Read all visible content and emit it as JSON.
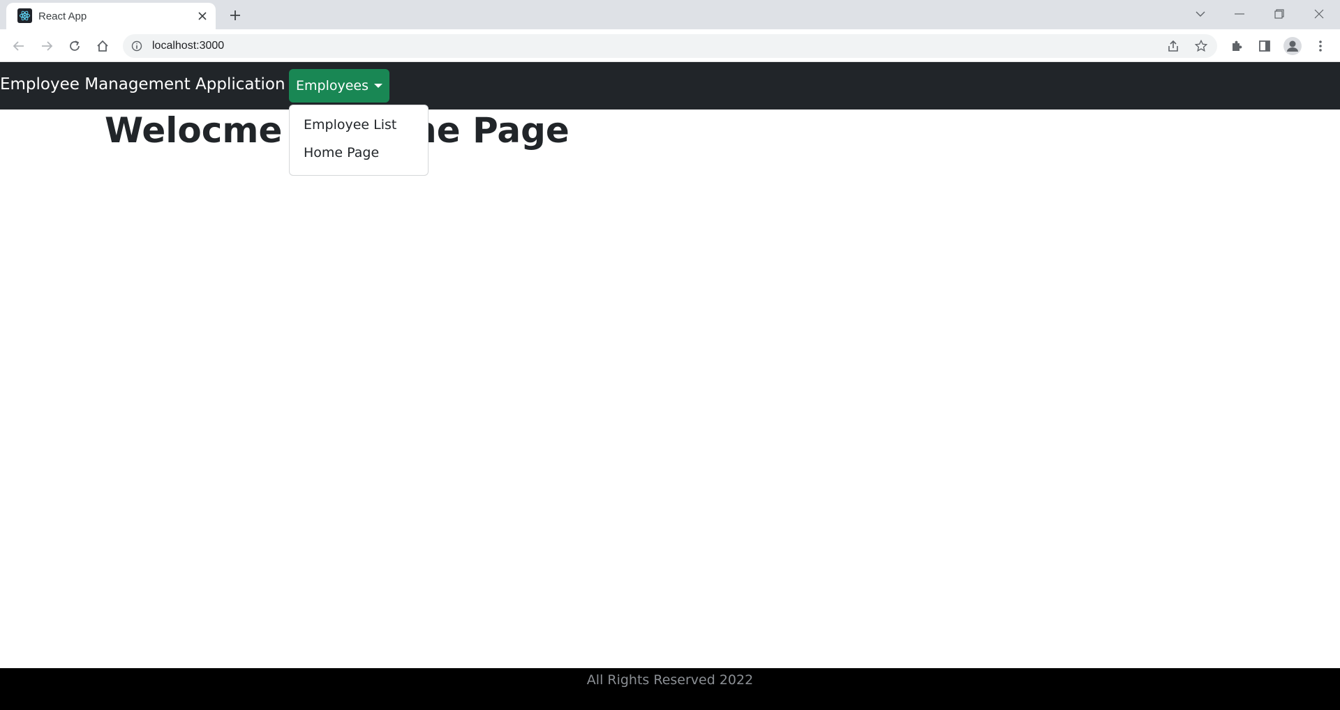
{
  "browser": {
    "tab_title": "React App",
    "url": "localhost:3000",
    "icons": {
      "favicon": "react-logo-icon",
      "close_tab": "close-icon",
      "new_tab": "plus-icon",
      "back": "arrow-left-icon",
      "forward": "arrow-right-icon",
      "reload": "reload-icon",
      "home": "home-icon",
      "site_info": "info-icon",
      "share": "share-icon",
      "bookmark": "star-icon",
      "extensions": "puzzle-icon",
      "side_panel": "side-panel-icon",
      "profile": "avatar-icon",
      "menu": "kebab-menu-icon"
    }
  },
  "navbar": {
    "brand": "Employee Management Application",
    "dropdown_label": "Employees",
    "dropdown_items": [
      {
        "label": "Employee List"
      },
      {
        "label": "Home Page"
      }
    ]
  },
  "main": {
    "heading": "Welocme to Home Page"
  },
  "footer": {
    "text": "All Rights Reserved 2022"
  },
  "colors": {
    "navbar_bg": "#212529",
    "dropdown_button": "#198754",
    "footer_bg": "#000000",
    "tabstrip_bg": "#dee1e6"
  }
}
